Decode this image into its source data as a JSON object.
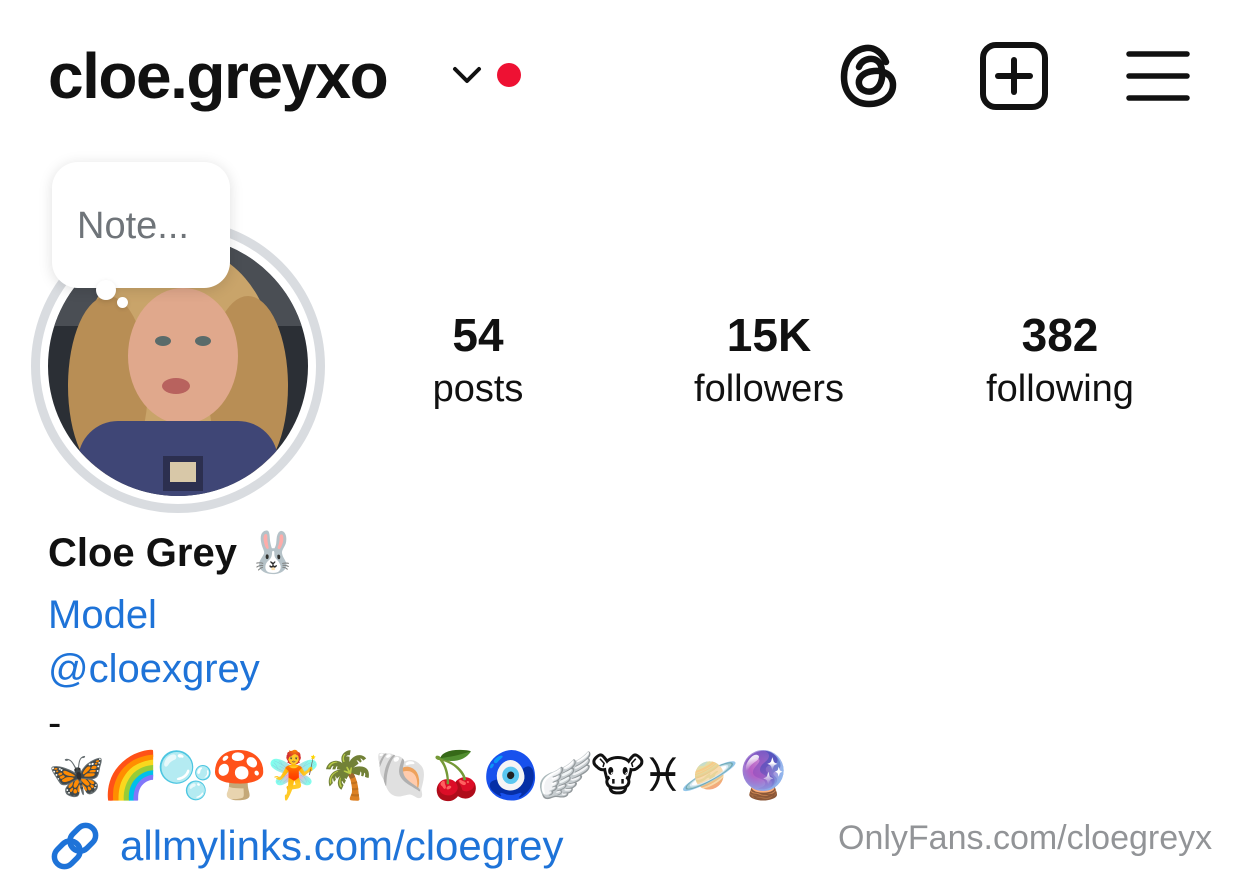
{
  "header": {
    "username": "cloe.greyxo",
    "switch_account_icon": "chevron-down-icon",
    "notification_dot_color": "#ee1133",
    "threads_icon": "threads-icon",
    "create_icon": "plus-square-icon",
    "menu_icon": "hamburger-menu-icon"
  },
  "note": {
    "placeholder": "Note..."
  },
  "stats": {
    "posts": {
      "count": "54",
      "label": "posts"
    },
    "followers": {
      "count": "15K",
      "label": "followers"
    },
    "following": {
      "count": "382",
      "label": "following"
    }
  },
  "bio": {
    "full_name": "Cloe Grey 🐰",
    "category": "Model",
    "mention": "@cloexgrey",
    "dash": "-",
    "emoji_line": "🦋🌈🫧🍄🧚🌴🐚🍒🧿🪽🐮♓🪐🔮",
    "link_icon": "link-icon",
    "link": "allmylinks.com/cloegrey"
  },
  "watermark": "OnlyFans.com/cloegreyx",
  "colors": {
    "link_blue": "#1e73d8",
    "ring_gray": "#d9dce0",
    "text": "#111111"
  }
}
